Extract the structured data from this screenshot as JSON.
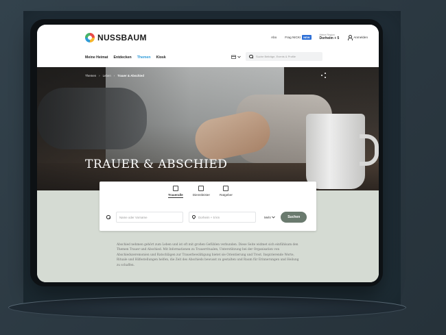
{
  "header": {
    "brand": "NUSSBAUM",
    "links": {
      "abo": "Abo",
      "frag_nicki": "Frag NICKI",
      "frag_badge": "NEW",
      "location_small": "Meine Region",
      "location_main": "Dorheim + 5",
      "login": "Anmelden"
    },
    "nav": [
      "Meine Heimat",
      "Entdecken",
      "Themen",
      "Kiosk"
    ],
    "nav_active": "Themen",
    "search_placeholder": "Suche Beiträge, Events & Profile"
  },
  "hero": {
    "breadcrumb": [
      "Themen",
      "Leben",
      "Trauer & Abschied"
    ],
    "title": "TRAUER & ABSCHIED"
  },
  "search_card": {
    "tabs": [
      "Traueralle",
      "Dienstleister",
      "Ratgeber"
    ],
    "active_tab": "Traueralle",
    "name_placeholder": "Name oder Vorname",
    "location_value": "Dorheim + 5 km",
    "more_label": "Mehr",
    "submit_label": "Suchen"
  },
  "intro_text": "Abschied nehmen gehört zum Leben und ist oft mit großen Gefühlen verbunden. Diese Seite widmet sich einfühlsam den Themen Trauer und Abschied. Mit Informationen zu Trauerritualen, Unterstützung bei der Organisation von Abschiedszeremonien und Ratschlägen zur Trauerbewältigung bietet sie Orientierung und Trost. Inspirierende Worte, Rituale und Hilfestellungen helfen, die Zeit des Abschieds bewusst zu gestalten und Raum für Erinnerungen und Heilung zu schaffen.",
  "colors": {
    "accent": "#2d9bd9",
    "button": "#6a7a6e",
    "lower_bg": "#d5dbd3"
  }
}
